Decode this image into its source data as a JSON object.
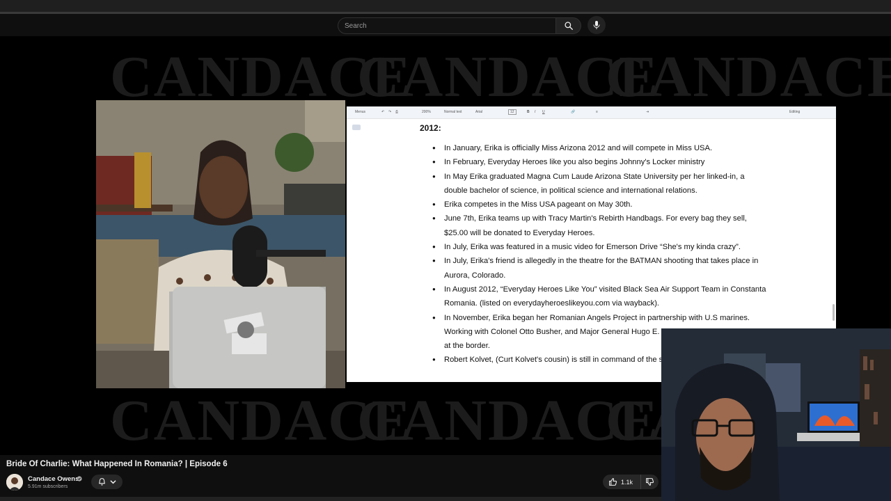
{
  "search": {
    "placeholder": "Search"
  },
  "player": {
    "background_wordmark": "CANDACE",
    "doc": {
      "toolbar": {
        "menus": "Menus",
        "zoom": "200%",
        "style": "Normal text",
        "font": "Arial",
        "font_size": "12",
        "bold": "B",
        "italic": "I",
        "underline": "U",
        "mode": "Editing"
      },
      "heading": "2012:",
      "bullets": [
        "In January, Erika is officially Miss Arizona 2012 and will compete in Miss USA.",
        "In February, Everyday Heroes like you also begins Johnny's Locker ministry",
        "In May Erika graduated Magna Cum Laude Arizona State University per her linked-in, a double bachelor of science, in political science and international relations.",
        "Erika competes in the Miss USA pageant on May 30th.",
        "June 7th, Erika teams up with Tracy Martin's Rebirth Handbags. For every bag they sell, $25.00 will be donated to Everyday Heroes.",
        "In July, Erika was featured in a music video for Emerson Drive “She's my kinda crazy”.",
        "In July, Erika's friend is allegedly in the theatre for the BATMAN shooting that takes place in Aurora, Colorado.",
        "In August 2012, “Everyday Heroes Like You” visited Black Sea Air Support Team in Constanta Romania. (listed on everydayheroeslikeyou.com via wayback).",
        "In November, Erika began her Romanian Angels Project in partnership with U.S marines. Working with Colonel Otto Busher, and Major General Hugo E. Salazar formerly of Narcotics at the border.",
        "Robert Kolvet, (Curt Kolvet's cousin) is still in command of the stationed in Afghanistan."
      ]
    }
  },
  "video": {
    "title": "Bride Of Charlie: What Happened In Romania? | Episode 6",
    "channel": "Candace Owens",
    "subscribers": "5.91m subscribers",
    "likes": "1.1k"
  },
  "colors": {
    "page_bg": "#0f0f0f",
    "doc_bg": "#ffffff",
    "wordmark": "#1c1c1c"
  }
}
